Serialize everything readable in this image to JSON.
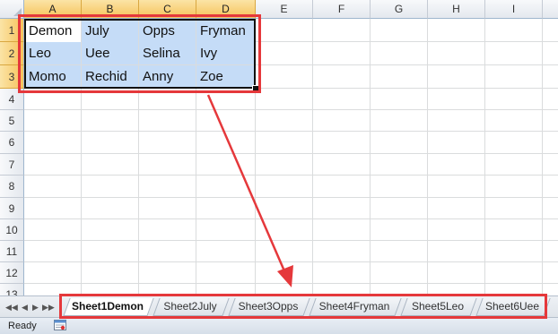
{
  "columns": [
    "A",
    "B",
    "C",
    "D",
    "E",
    "F",
    "G",
    "H",
    "I"
  ],
  "rows": [
    "1",
    "2",
    "3",
    "4",
    "5",
    "6",
    "7",
    "8",
    "9",
    "10",
    "11",
    "12",
    "13"
  ],
  "cells": [
    [
      "Demon",
      "July",
      "Opps",
      "Fryman"
    ],
    [
      "Leo",
      "Uee",
      "Selina",
      "Ivy"
    ],
    [
      "Momo",
      "Rechid",
      "Anny",
      "Zoe"
    ]
  ],
  "sheet_tabs": [
    "Sheet1Demon",
    "Sheet2July",
    "Sheet3Opps",
    "Sheet4Fryman",
    "Sheet5Leo",
    "Sheet6Uee"
  ],
  "active_tab": "Sheet1Demon",
  "status": "Ready",
  "colors": {
    "selection_fill": "#c5dcf7",
    "annotation_red": "#e5383b",
    "header_selected": "#f6c35b"
  },
  "icons": {
    "first_sheet": "◀◀",
    "prev_sheet": "◀",
    "next_sheet": "▶",
    "last_sheet": "▶▶"
  }
}
